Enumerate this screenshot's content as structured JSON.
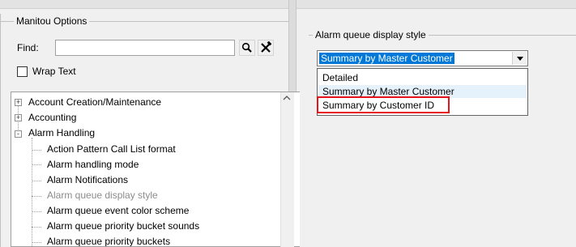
{
  "header": {
    "left_label": "",
    "right_label": ""
  },
  "options_group": {
    "title": "Manitou Options",
    "find_label": "Find:",
    "find_value": "",
    "search_icon": "magnifier-icon",
    "tools_icon": "wrench-hammer-icon",
    "wrap_text_label": "Wrap Text",
    "wrap_text_checked": false
  },
  "tree": {
    "items": [
      {
        "label": "Account Creation/Maintenance",
        "expander": "+",
        "level": 0
      },
      {
        "label": "Accounting",
        "expander": "+",
        "level": 0
      },
      {
        "label": "Alarm Handling",
        "expander": "-",
        "level": 0
      },
      {
        "label": "Action Pattern Call List format",
        "level": 1
      },
      {
        "label": "Alarm handling mode",
        "level": 1
      },
      {
        "label": "Alarm Notifications",
        "level": 1
      },
      {
        "label": "Alarm queue display style",
        "level": 1,
        "selected": true
      },
      {
        "label": "Alarm queue event color scheme",
        "level": 1
      },
      {
        "label": "Alarm queue priority bucket sounds",
        "level": 1
      },
      {
        "label": "Alarm queue priority buckets",
        "level": 1
      }
    ],
    "scroll_up_icon": "chevron-up-icon"
  },
  "setting": {
    "title": "Alarm queue display style",
    "combo_value": "Summary by Master Customer",
    "dropdown_icon": "chevron-down-icon",
    "options": [
      "Detailed",
      "Summary by Master Customer",
      "Summary by Customer ID"
    ]
  },
  "colors": {
    "selection": "#0078d7",
    "hover": "#e5f1fb",
    "highlight_border": "#e8121b",
    "disabled_text": "#8c8c8c"
  }
}
